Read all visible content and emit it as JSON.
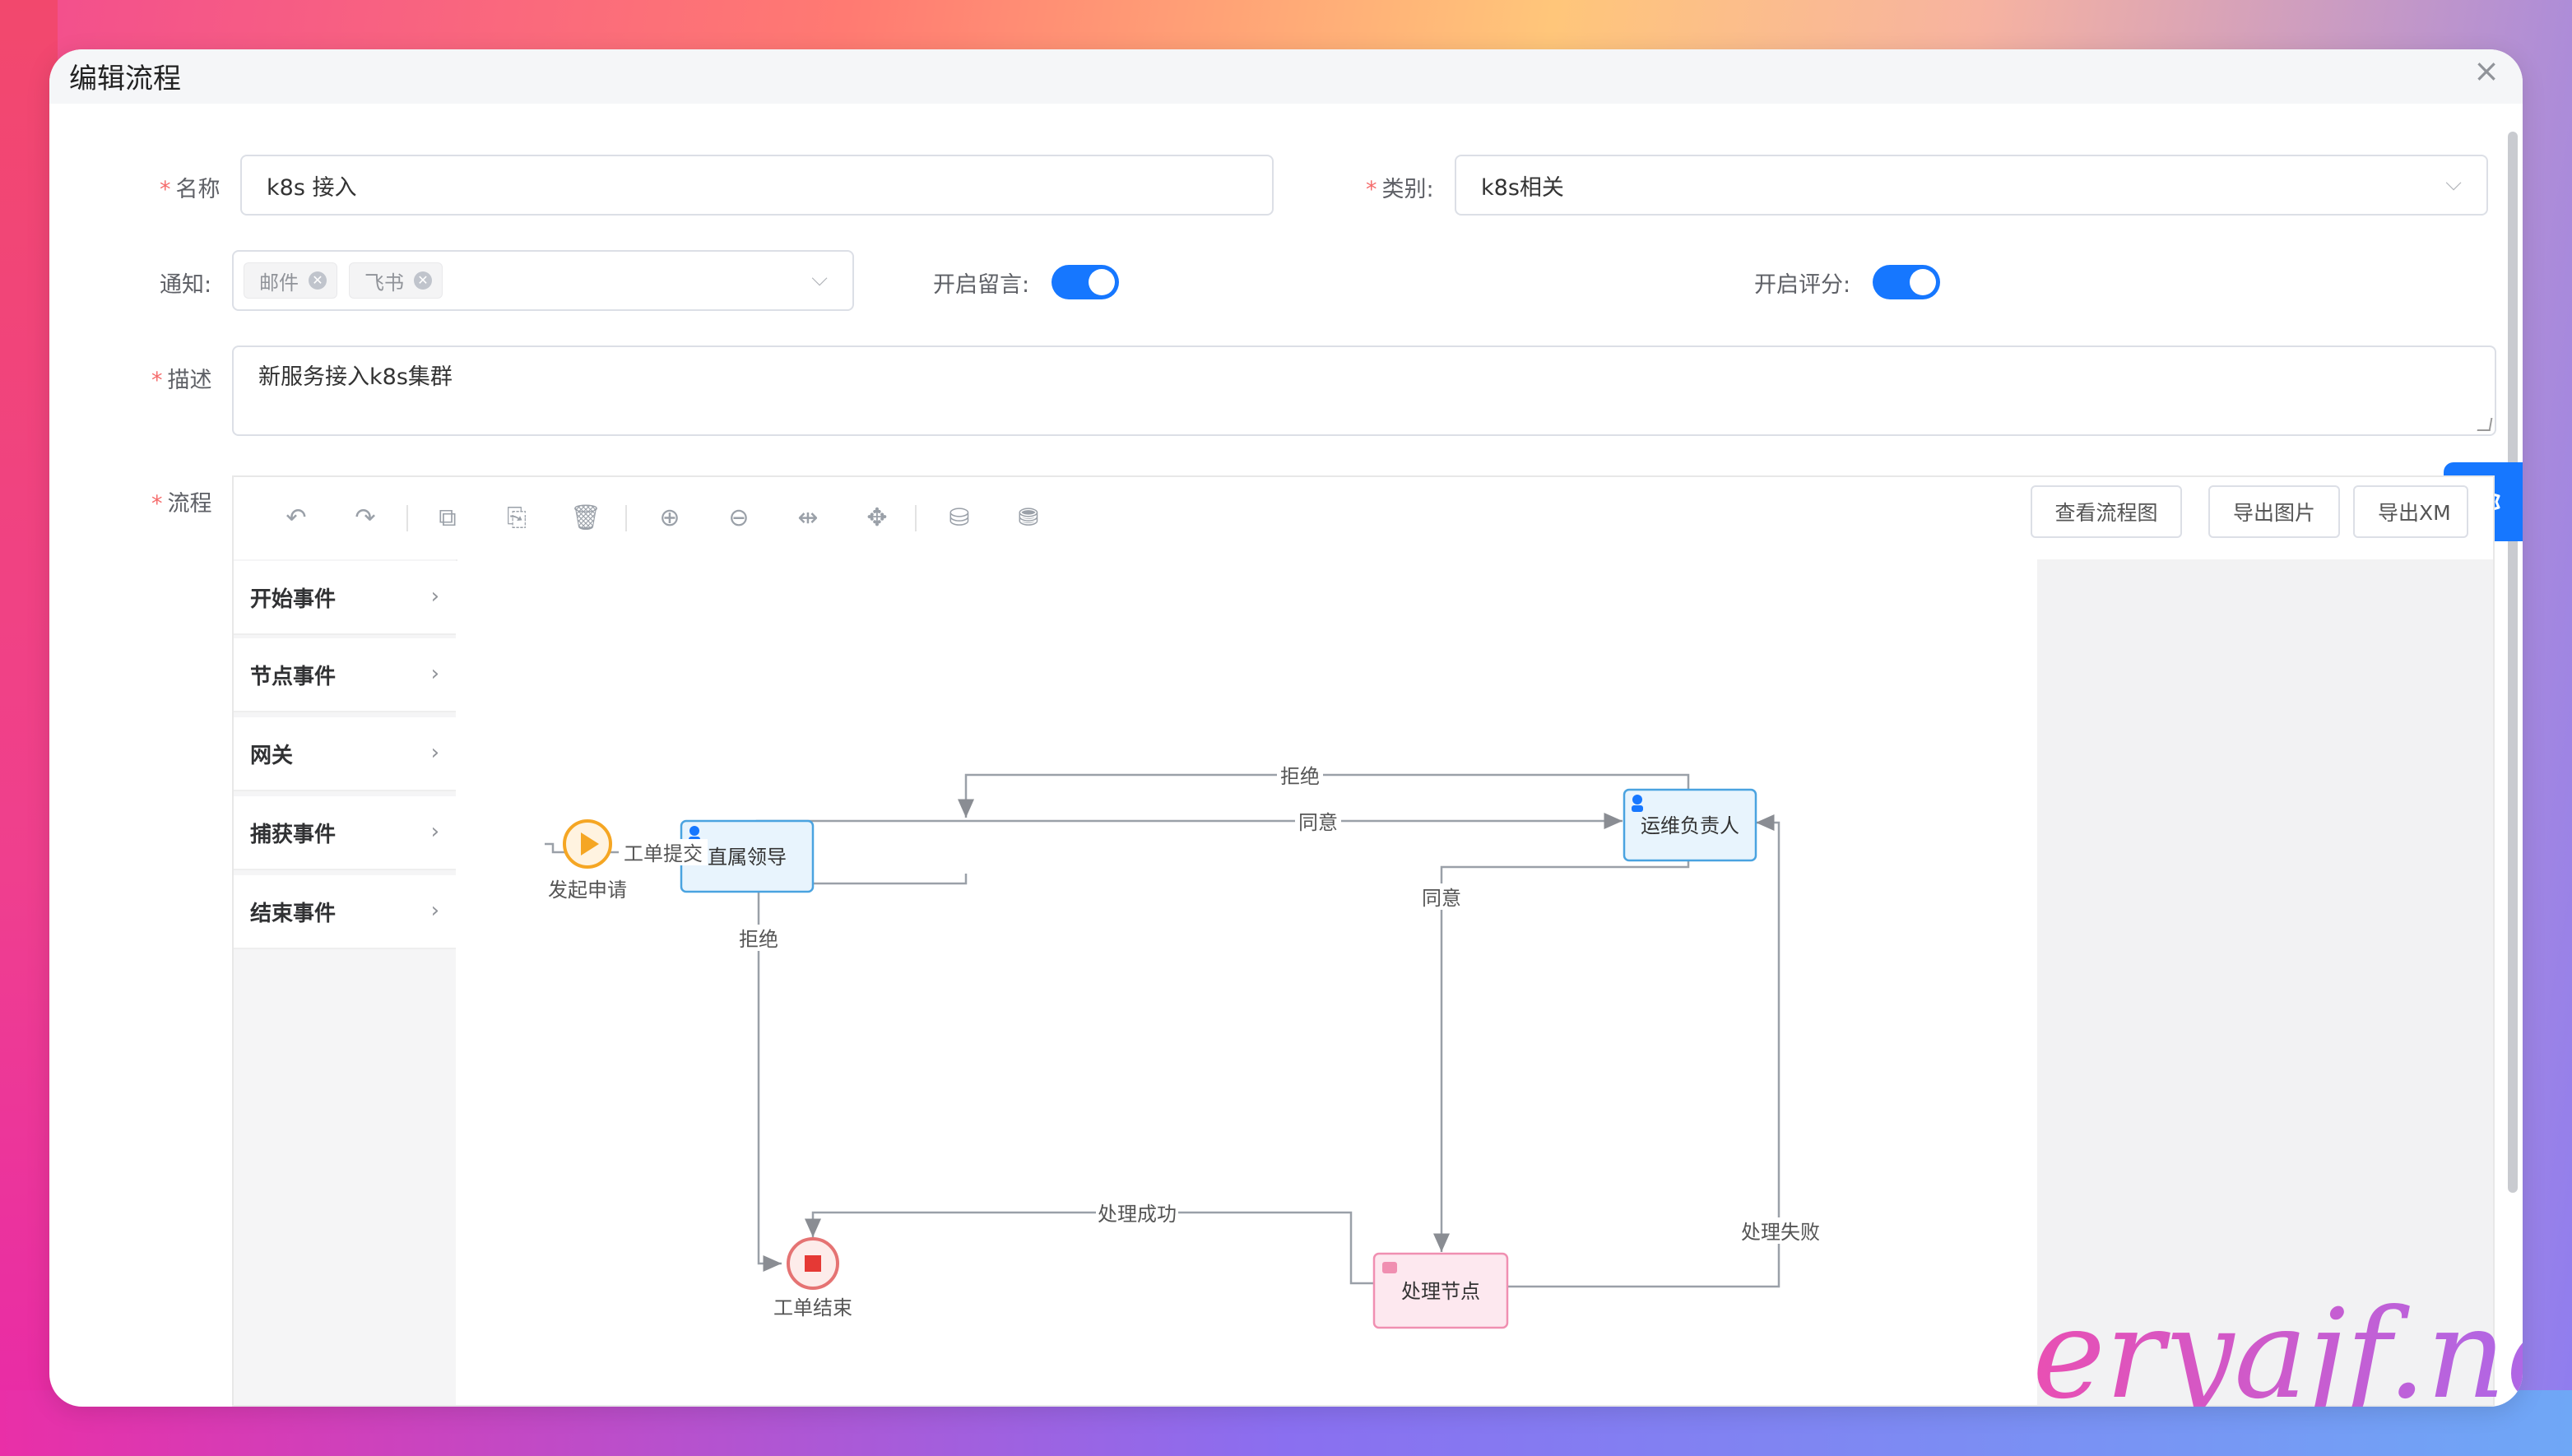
{
  "dialog": {
    "title": "编辑流程",
    "close": "×"
  },
  "form": {
    "name_label": "名称",
    "name_value": "k8s 接入",
    "category_label": "类别:",
    "category_value": "k8s相关",
    "notify_label": "通知:",
    "notify_tags": [
      "邮件",
      "飞书"
    ],
    "comment_label": "开启留言:",
    "comment_enabled": true,
    "rating_label": "开启评分:",
    "rating_enabled": true,
    "desc_label": "描述",
    "desc_value": "新服务接入k8s集群",
    "flow_label": "流程"
  },
  "toolbar": {
    "view_button": "查看流程图",
    "export_image_button": "导出图片",
    "export_xml_button": "导出XM"
  },
  "palette": [
    "开始事件",
    "节点事件",
    "网关",
    "捕获事件",
    "结束事件"
  ],
  "diagram": {
    "start_label": "发起申请",
    "task_leader": "直属领导",
    "task_ops": "运维负责人",
    "task_process": "处理节点",
    "end_label": "工单结束",
    "flow_submit": "工单提交",
    "flow_reject_top": "拒绝",
    "flow_agree_top": "同意",
    "flow_agree_ops": "同意",
    "flow_reject_left": "拒绝",
    "flow_success": "处理成功",
    "flow_fail": "处理失败"
  },
  "watermark": "eryajf.net",
  "colors": {
    "accent": "#1677ff",
    "start": "#f5a623",
    "end": "#e53935"
  }
}
